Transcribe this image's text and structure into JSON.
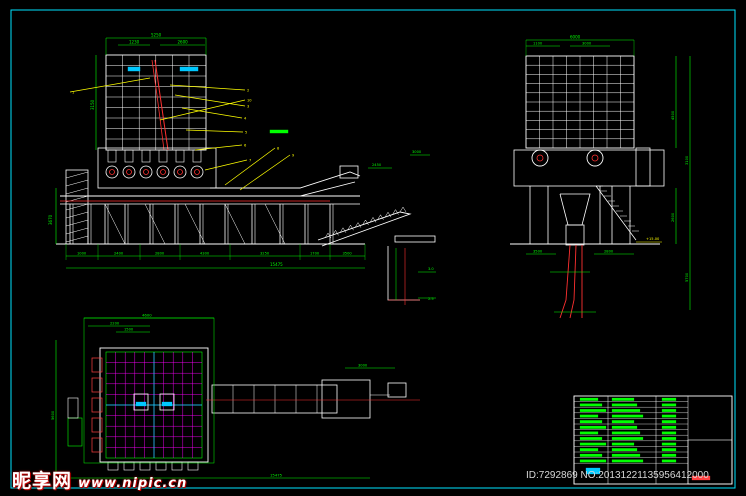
{
  "drawing": {
    "colors": {
      "background": "#000000",
      "frame": "#00e5ff",
      "structure": "#ffffff",
      "dimension": "#00ff00",
      "leader": "#ffff00",
      "centerline": "#ff3030",
      "grid": "#ff00ff",
      "accent": "#ff4040",
      "label_fill": "#00c8ff"
    },
    "front_view": {
      "top_dims": [
        "5250",
        "1230",
        "2600"
      ],
      "height_dim": "3150",
      "left_height_dim": "3670",
      "bottom_dims": [
        "1000",
        "2400",
        "2800",
        "4300",
        "3250",
        "1700",
        "3500"
      ],
      "overall_length": "15475",
      "conveyor_dims": [
        "2450",
        "3000"
      ],
      "side_dims": [
        "3.0",
        "2.5"
      ],
      "leader_tags": [
        "1",
        "2",
        "3",
        "4",
        "5",
        "6",
        "7",
        "8",
        "9",
        "10"
      ]
    },
    "side_view": {
      "top_dims": [
        "6000",
        "1100",
        "3000"
      ],
      "height_dims": [
        "4500",
        "2600",
        "3100",
        "5700"
      ],
      "level_mark": "+15.00",
      "bottom_dims": [
        "3500",
        "2800"
      ]
    },
    "plan_view": {
      "top_dims": [
        "4600",
        "2200",
        "1500"
      ],
      "left_dim": "5600",
      "overall_length": "15475",
      "conveyor_dim": "3000"
    },
    "title_block": {
      "rows": 12,
      "cols": 3
    }
  },
  "watermark": {
    "logo_text": "昵享网",
    "url_text": "www.nipic.cn",
    "id_text": "ID:7292869 NO:20131221135956412000"
  }
}
